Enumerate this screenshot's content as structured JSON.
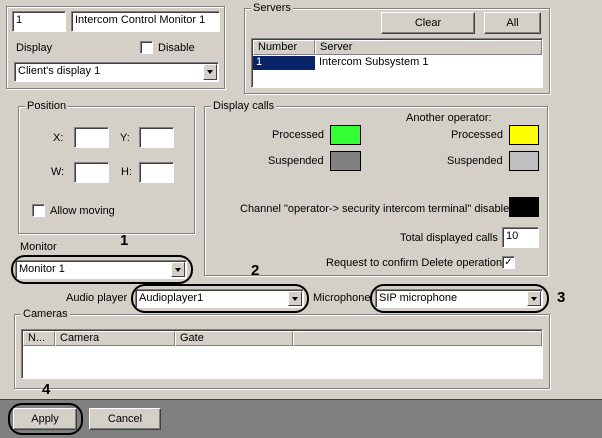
{
  "object": {
    "id": "1",
    "name": "Intercom Control Monitor 1",
    "display_label": "Display",
    "disable_label": "Disable",
    "display_value": "Client's display 1"
  },
  "servers": {
    "title": "Servers",
    "clear_label": "Clear",
    "all_label": "All",
    "columns": [
      "Number",
      "Server"
    ],
    "rows": [
      {
        "number": "1",
        "server": "Intercom Subsystem 1"
      }
    ]
  },
  "position": {
    "title": "Position",
    "x_label": "X:",
    "y_label": "Y:",
    "w_label": "W:",
    "h_label": "H:",
    "x_value": "",
    "y_value": "",
    "w_value": "",
    "h_value": "",
    "allow_moving_label": "Allow moving"
  },
  "monitor": {
    "label": "Monitor",
    "value": "Monitor 1"
  },
  "display_calls": {
    "title": "Display calls",
    "another_operator_label": "Another operator:",
    "processed_label": "Processed",
    "suspended_label": "Suspended",
    "another_processed_label": "Processed",
    "another_suspended_label": "Suspended",
    "channel_label": "Channel \"operator-> security intercom terminal\" disabled",
    "total_label": "Total displayed calls",
    "total_value": "10",
    "confirm_label": "Request to confirm Delete operation",
    "confirm_checked": "✓",
    "colors": {
      "processed": "#33ff33",
      "suspended": "#808080",
      "another_processed": "#ffff00",
      "another_suspended": "#c0c0c0",
      "channel_disabled": "#000000"
    }
  },
  "audio": {
    "label": "Audio player",
    "value": "Audioplayer1"
  },
  "microphone": {
    "label": "Microphone",
    "value": "SIP microphone"
  },
  "cameras": {
    "title": "Cameras",
    "columns": [
      "N...",
      "Camera",
      "Gate"
    ]
  },
  "footer": {
    "apply_label": "Apply",
    "cancel_label": "Cancel"
  },
  "callouts": [
    "1",
    "2",
    "3",
    "4"
  ]
}
